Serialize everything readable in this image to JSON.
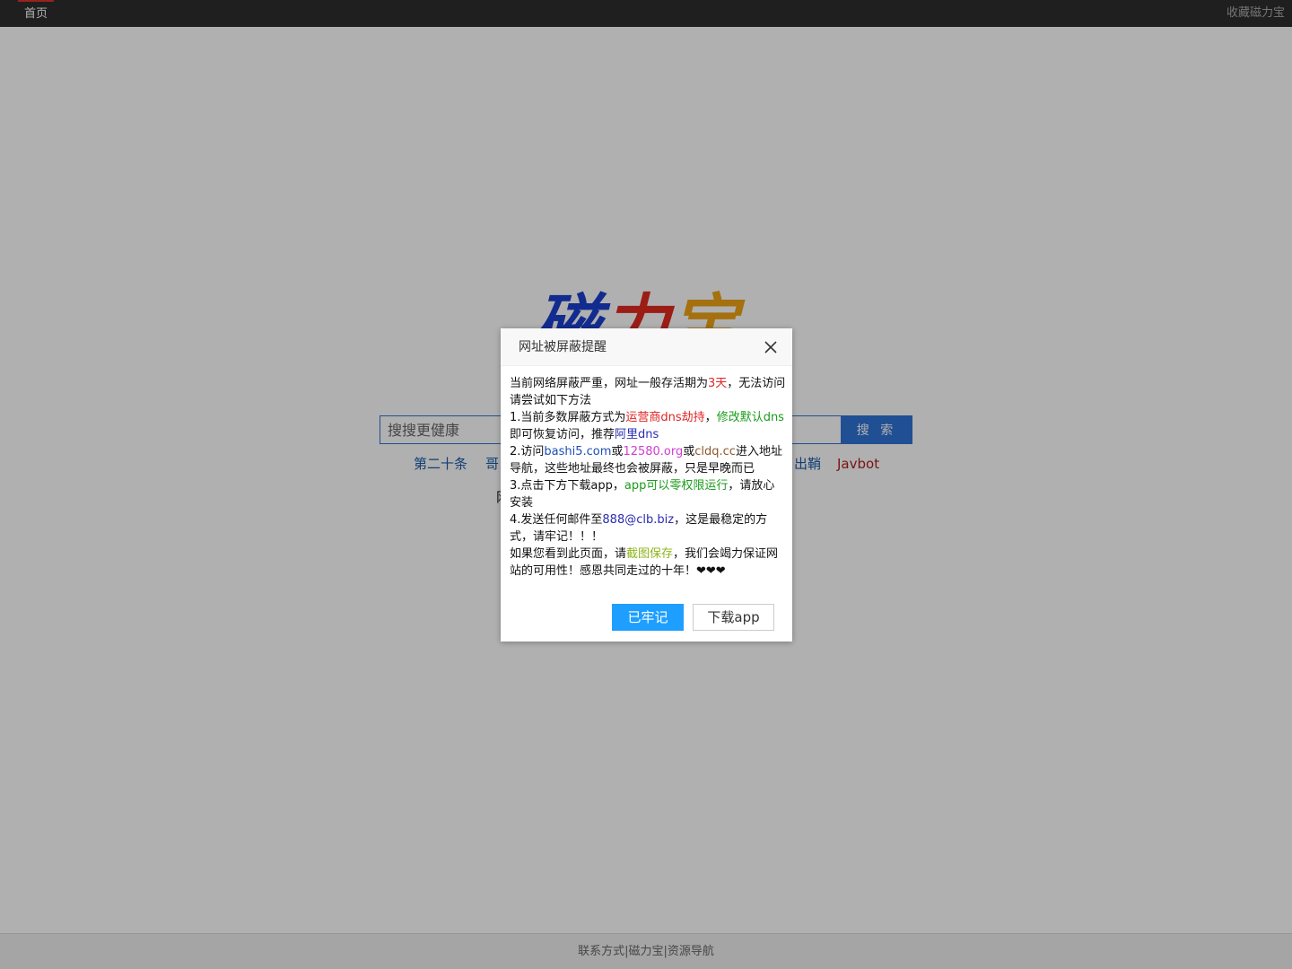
{
  "topbar": {
    "home_label": "首页",
    "favorite_label": "收藏磁力宝"
  },
  "logo": {
    "char1": "磁",
    "char2": "力",
    "char3": "宝",
    "colors": [
      "#1b3fd0",
      "#e12a1f",
      "#f0a416"
    ]
  },
  "search": {
    "placeholder": "搜搜更健康",
    "button_label": "搜 索"
  },
  "quick_links": [
    {
      "label": "第二十条"
    },
    {
      "label": "哥"
    },
    {
      "label": "出鞘"
    },
    {
      "label": "Javbot"
    }
  ],
  "second_line_fragment": "网",
  "footer": {
    "text": "联系方式|磁力宝|资源导航"
  },
  "dialog": {
    "title": "网址被屏蔽提醒",
    "lines": {
      "intro_a": "当前网络屏蔽严重，网址一般存活期为",
      "intro_days": "3天",
      "intro_b": "，无法访问请尝试如下方法",
      "m1_a": "1.当前多数屏蔽方式为",
      "m1_hijack": "运营商dns劫持",
      "m1_comma": "，",
      "m1_modify": "修改默认dns",
      "m1_b": "即可恢复访问，推荐",
      "m1_ali": "阿里dns",
      "m2_a": "2.访问",
      "m2_site1": "bashi5.com",
      "m2_or1": "或",
      "m2_site2": "12580.org",
      "m2_or2": "或",
      "m2_site3": "cldq.cc",
      "m2_b": "进入地址导航，这些地址最终也会被屏蔽，只是早晚而已",
      "m3_a": "3.点击下方下载app，",
      "m3_green": "app可以零权限运行",
      "m3_b": "，请放心安装",
      "m4_a": "4.发送任何邮件至",
      "m4_email": "888@clb.biz",
      "m4_b": "，这是最稳定的方式，请牢记！！！",
      "end_a": "如果您看到此页面，请",
      "end_screenshot": "截图保存",
      "end_b": "，我们会竭力保证网站的可用性！感恩共同走过的十年！❤❤❤"
    },
    "remember_button": "已牢记",
    "download_button": "下载app"
  }
}
